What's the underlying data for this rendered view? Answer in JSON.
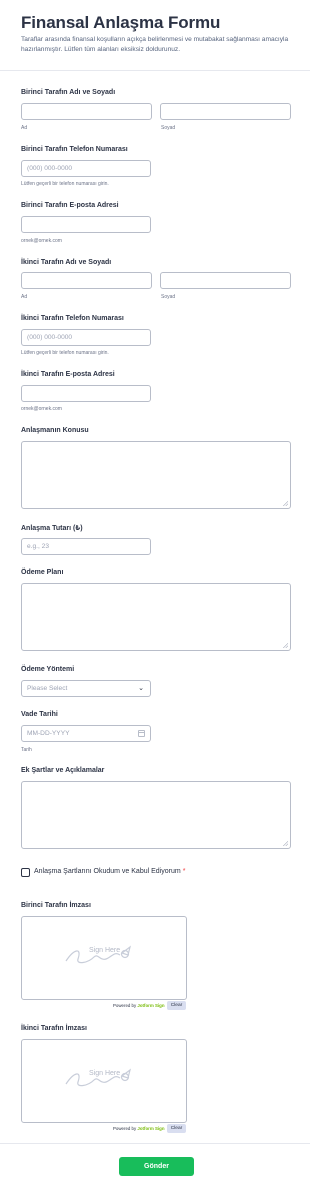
{
  "form": {
    "title": "Finansal Anlaşma Formu",
    "description": "Taraflar arasında finansal koşulların açıkça belirlenmesi ve mutabakat sağlanması amacıyla hazırlanmıştır. Lütfen tüm alanları eksiksiz doldurunuz."
  },
  "party1": {
    "name_label": "Birinci Tarafın Adı ve Soyadı",
    "first_sublabel": "Ad",
    "last_sublabel": "Soyad",
    "phone_label": "Birinci Tarafın Telefon Numarası",
    "phone_placeholder": "(000) 000-0000",
    "phone_sublabel": "Lütfen geçerli bir telefon numarası girin.",
    "email_label": "Birinci Tarafın E-posta Adresi",
    "email_sublabel": "ornek@ornek.com"
  },
  "party2": {
    "name_label": "İkinci Tarafın Adı ve Soyadı",
    "first_sublabel": "Ad",
    "last_sublabel": "Soyad",
    "phone_label": "İkinci Tarafın Telefon Numarası",
    "phone_placeholder": "(000) 000-0000",
    "phone_sublabel": "Lütfen geçerli bir telefon numarası girin.",
    "email_label": "İkinci Tarafın E-posta Adresi",
    "email_sublabel": "ornek@ornek.com"
  },
  "subject": {
    "label": "Anlaşmanın Konusu"
  },
  "amount": {
    "label": "Anlaşma Tutarı (₺)",
    "placeholder": "e.g., 23"
  },
  "payment_plan": {
    "label": "Ödeme Planı"
  },
  "payment_method": {
    "label": "Ödeme Yöntemi",
    "selected": "Please Select"
  },
  "due_date": {
    "label": "Vade Tarihi",
    "placeholder": "MM-DD-YYYY",
    "sublabel": "Tarih"
  },
  "extra_terms": {
    "label": "Ek Şartlar ve Açıklamalar"
  },
  "agreement": {
    "label": "Anlaşma Şartlarını Okudum ve Kabul Ediyorum",
    "required_mark": "*"
  },
  "signature1": {
    "label": "Birinci Tarafın İmzası"
  },
  "signature2": {
    "label": "İkinci Tarafın İmzası"
  },
  "signature": {
    "prompt": "Sign Here",
    "powered_prefix": "Powered by",
    "powered_brand": "Jotform Sign",
    "clear_label": "Clear"
  },
  "submit": {
    "label": "Gönder"
  },
  "colors": {
    "submit": "#18bd5b",
    "required": "#f23a3c",
    "brand": "#78bb07",
    "text": "#2c3345"
  },
  "icons": [
    "calendar-icon",
    "chevron-down-icon",
    "signature-scrawl-icon"
  ]
}
